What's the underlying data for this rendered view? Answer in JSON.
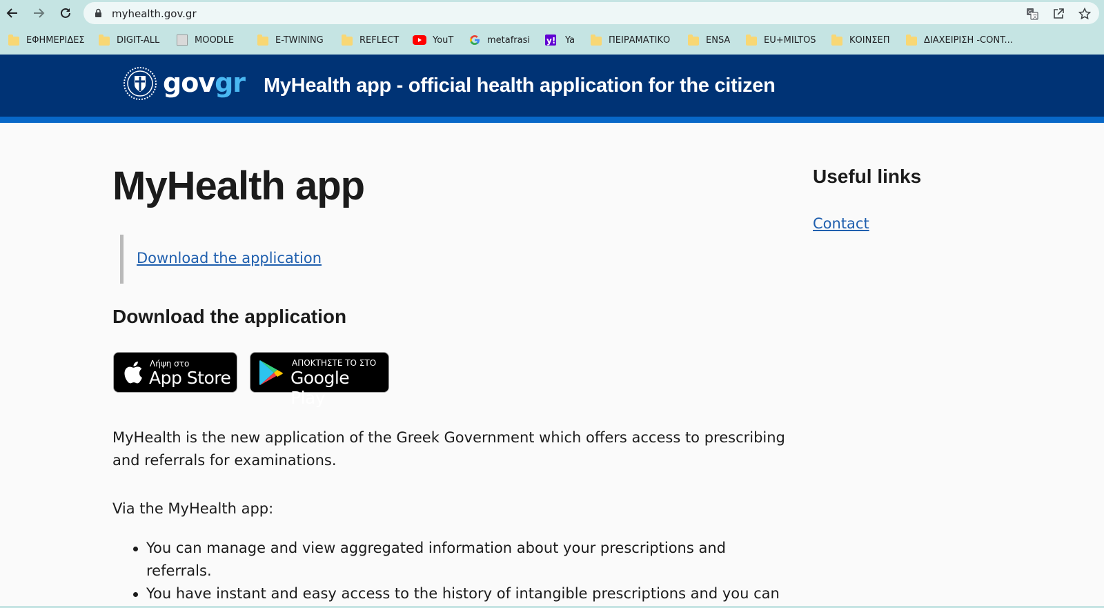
{
  "browser": {
    "url": "myhealth.gov.gr",
    "bookmarks": [
      {
        "label": "ΕΦΗΜΕΡΙΔΕΣ",
        "icon": "folder-icon"
      },
      {
        "label": "DIGIT-ALL",
        "icon": "folder-icon"
      },
      {
        "label": "MOODLE",
        "icon": "moodle-icon"
      },
      {
        "label": "E-TWINING",
        "icon": "folder-icon"
      },
      {
        "label": "REFLECT",
        "icon": "folder-icon"
      },
      {
        "label": "YouT",
        "icon": "youtube-icon"
      },
      {
        "label": "metafrasi",
        "icon": "google-icon"
      },
      {
        "label": "Ya",
        "icon": "yahoo-icon"
      },
      {
        "label": "ΠΕΙΡΑΜΑΤΙΚΟ",
        "icon": "folder-icon"
      },
      {
        "label": "ENSA",
        "icon": "folder-icon"
      },
      {
        "label": "EU+MILTOS",
        "icon": "folder-icon"
      },
      {
        "label": "ΚΟΙΝΣΕΠ",
        "icon": "folder-icon"
      },
      {
        "label": "ΔΙΑΧΕΙΡΙΣΗ -CONT...",
        "icon": "folder-icon"
      }
    ]
  },
  "header": {
    "logo_part1": "gov",
    "logo_part2": "gr",
    "title": "MyHealth app - official health application for the citizen"
  },
  "main": {
    "title": "MyHealth app",
    "quote_link": "Download the application",
    "download_heading": "Download the application",
    "appstore": {
      "small": "Λήψη στο",
      "big": "App Store"
    },
    "googleplay": {
      "small": "ΑΠΟΚΤΗΣΤΕ ΤΟ ΣΤΟ",
      "big": "Google Play"
    },
    "intro": "MyHealth is the new application of the Greek Government which offers access to prescribing and referrals for examinations.",
    "via": "Via the MyHealth app:",
    "bullets": [
      "You can manage and view aggregated information about your prescriptions and referrals.",
      "You have instant and easy access to the history of intangible prescriptions and you can receive notifications via Push Notifications for new prescriptions and exam referrals."
    ]
  },
  "aside": {
    "title": "Useful links",
    "contact": "Contact"
  },
  "colors": {
    "header_bg": "#003375",
    "header_stripe": "#0868c8",
    "link": "#1f5fae",
    "chrome_bg": "#c5e4e3"
  }
}
